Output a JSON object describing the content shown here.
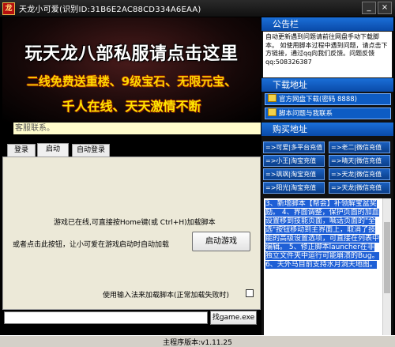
{
  "window": {
    "title": "天龙小可爱(识别ID:31B6E2AC88CD334A6EAA)",
    "icon": "tianlong-app-icon",
    "min_label": "_",
    "close_label": "×"
  },
  "banner": {
    "line1": "玩天龙八部私服请点击这里",
    "line2": "二线免费送重楼、9级宝石、无限元宝、",
    "line3": "千人在线、天天激情不断"
  },
  "service_text": "客服联系。",
  "tabs": [
    {
      "label": "登录"
    },
    {
      "label": "启动"
    },
    {
      "label": "自动登录"
    }
  ],
  "main": {
    "message1": "游戏已在线,可直接按Home键(或 Ctrl+H)加载脚本",
    "message2": "或者点击此按钮，让小可爱在游戏启动时自动加载",
    "launch_button": "启动游戏",
    "ime_label": "使用输入法来加载脚本(正常加载失败时)"
  },
  "bottom": {
    "find_exe_button": "找game.exe",
    "version": "主程序版本:v1.11.25"
  },
  "notice": {
    "header": "公告栏",
    "text": "自动更新遇到问题请前往网盘手动下载脚本。 如使用脚本过程中遇到问题，请点击下方链接，通过qq向我们反馈。问题反馈qq:508326387"
  },
  "download": {
    "header": "下载地址",
    "items": [
      {
        "label": "官方网盘下载(密码 8888)"
      },
      {
        "label": "脚本问题与我联系"
      }
    ]
  },
  "buy": {
    "header": "购买地址",
    "buttons": [
      {
        "label": "=>可爱|多平台充值"
      },
      {
        "label": "=>老二|微信充值"
      },
      {
        "label": "=>小王|淘宝充值"
      },
      {
        "label": "=>晴天|微信充值"
      },
      {
        "label": "=>飒飒|淘宝充值"
      },
      {
        "label": "=>天龙|微信充值"
      },
      {
        "label": "=>阳光|淘宝充值"
      },
      {
        "label": "=>天龙|微信充值"
      }
    ]
  },
  "faq": {
    "text": "3、新增脚本【帮会】补领解宝盆奖励。 4、界面调整，保护页面的加血设置移到技能页面，喊话页面的\"全选\"按钮移动到主界面上，取消了技能的高级设置选项，可直接在列表中编辑。 5、修正脚本launcher在非独立文件夹中运行可能崩溃的Bug。 6、天外马目前支持水月洞天地图。"
  },
  "colors": {
    "accent_blue": "#0d5cc4",
    "banner_yellow": "#ffd800",
    "service_bg": "#fffccc"
  }
}
